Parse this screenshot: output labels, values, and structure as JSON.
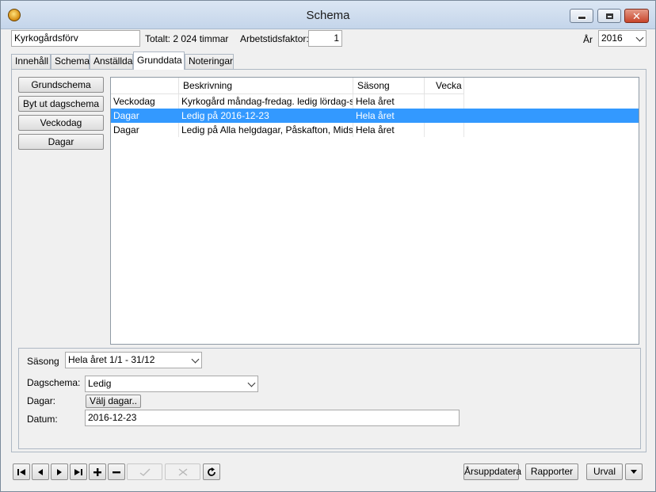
{
  "window": {
    "title": "Schema"
  },
  "header": {
    "unit_value": "Kyrkogårdsförv",
    "total_text": "Totalt: 2 024 timmar",
    "factor_label": "Arbetstidsfaktor:",
    "factor_value": "1",
    "year_label": "År",
    "year_value": "2016"
  },
  "tabs": [
    {
      "label": "Innehåll"
    },
    {
      "label": "Schema"
    },
    {
      "label": "Anställda"
    },
    {
      "label": "Grunddata"
    },
    {
      "label": "Noteringar"
    }
  ],
  "side_buttons": [
    {
      "label": "Grundschema"
    },
    {
      "label": "Byt ut dagschema"
    },
    {
      "label": "Veckodag"
    },
    {
      "label": "Dagar"
    }
  ],
  "grid": {
    "columns": [
      "",
      "Beskrivning",
      "Säsong",
      "Vecka"
    ],
    "rows": [
      [
        "Veckodag",
        "Kyrkogård måndag-fredag. ledig lördag-s...",
        "Hela året",
        ""
      ],
      [
        "Dagar",
        "Ledig på 2016-12-23",
        "Hela året",
        ""
      ],
      [
        "Dagar",
        "Ledig på Alla helgdagar, Påskafton, Midso...",
        "Hela året",
        ""
      ]
    ]
  },
  "detail": {
    "season_label": "Säsong",
    "season_value": "Hela året 1/1 - 31/12",
    "dayschema_label": "Dagschema:",
    "dayschema_value": "Ledig",
    "days_label": "Dagar:",
    "choose_days_label": "Välj dagar..",
    "date_label": "Datum:",
    "date_value": "2016-12-23"
  },
  "footer": {
    "year_update_label": "Årsuppdatera",
    "reports_label": "Rapporter",
    "selection_label": "Urval"
  }
}
